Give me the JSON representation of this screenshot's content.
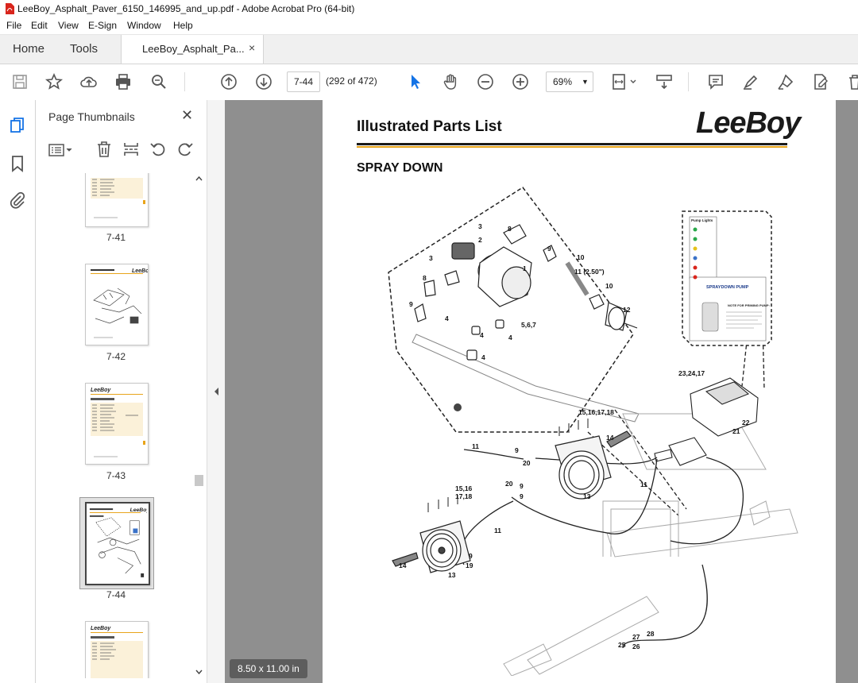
{
  "window": {
    "title": "LeeBoy_Asphalt_Paver_6150_146995_and_up.pdf - Adobe Acrobat Pro (64-bit)"
  },
  "menu": [
    "File",
    "Edit",
    "View",
    "E-Sign",
    "Window",
    "Help"
  ],
  "tabs": {
    "home": "Home",
    "tools": "Tools",
    "document": "LeeBoy_Asphalt_Pa...",
    "close": "×"
  },
  "toolbar": {
    "page_input": "7-44",
    "page_count": "(292 of 472)",
    "zoom": "69%"
  },
  "thumbnails": {
    "title": "Page Thumbnails",
    "pages": [
      {
        "label": "7-41"
      },
      {
        "label": "7-42"
      },
      {
        "label": "7-43"
      },
      {
        "label": "7-44",
        "selected": true
      },
      {
        "label": ""
      }
    ]
  },
  "document": {
    "heading": "Illustrated Parts List",
    "logo": "LeeBoy",
    "section": "SPRAY DOWN",
    "callouts": [
      "1",
      "2",
      "3",
      "3",
      "4",
      "4",
      "4",
      "4",
      "5,6,7",
      "8",
      "8",
      "9",
      "9",
      "9",
      "9",
      "9",
      "9",
      "10",
      "10",
      "11 (2.50\")",
      "11",
      "11",
      "11",
      "12",
      "13",
      "13",
      "14",
      "14",
      "15,16,17,18",
      "15,16",
      "17,18",
      "19",
      "20",
      "20",
      "21",
      "22",
      "23,24,17",
      "25",
      "26",
      "27",
      "28"
    ],
    "inset": {
      "header": "Pump Lights",
      "title": "SPRAYDOWN PUMP",
      "note": "NOTE FOR PRIMING PUMP:"
    }
  },
  "status": {
    "page_size": "8.50 x 11.00 in"
  },
  "colors": {
    "accent_orange": "#e8a41a",
    "selected_blue": "#1473e6",
    "doc_background": "#8f8f8f",
    "pdf_red": "#d9251c"
  }
}
